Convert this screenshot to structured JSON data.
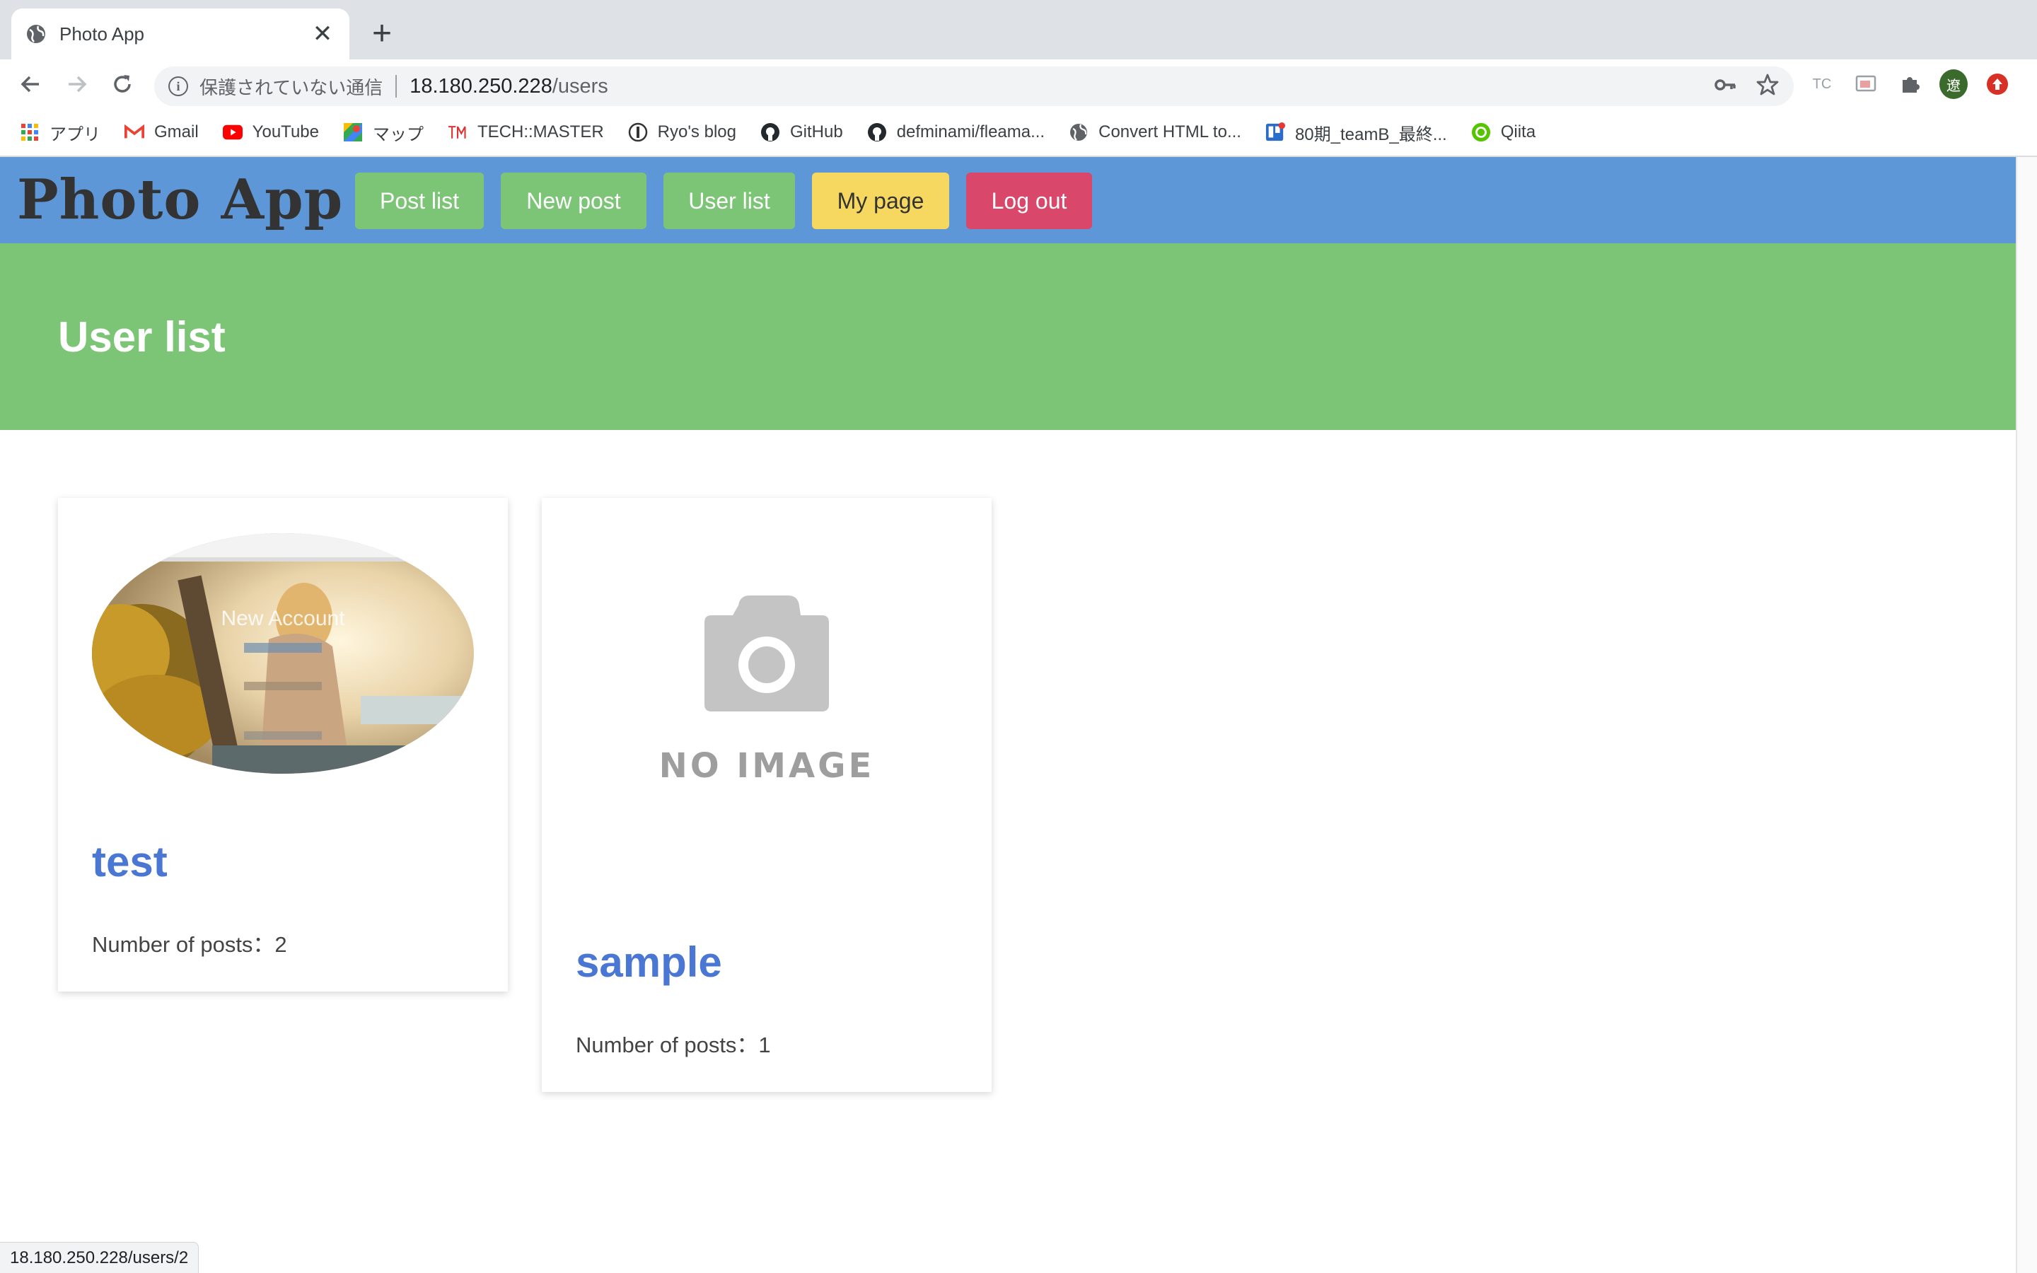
{
  "browser": {
    "tab_title": "Photo App",
    "new_tab_symbol": "+",
    "close_symbol": "✕",
    "security_text": "保護されていない通信",
    "url_host": "18.180.250.228",
    "url_path": "/users",
    "profile_initial": "遼",
    "ext_tc": "TC",
    "status_url": "18.180.250.228/users/2",
    "bookmarks": [
      {
        "label": "アプリ",
        "icon": "apps-grid-icon"
      },
      {
        "label": "Gmail",
        "icon": "gmail-icon"
      },
      {
        "label": "YouTube",
        "icon": "youtube-icon"
      },
      {
        "label": "マップ",
        "icon": "maps-icon"
      },
      {
        "label": "TECH::MASTER",
        "icon": "techmaster-icon"
      },
      {
        "label": "Ryo's blog",
        "icon": "blog-icon"
      },
      {
        "label": "GitHub",
        "icon": "github-icon"
      },
      {
        "label": "defminami/fleama...",
        "icon": "github-icon"
      },
      {
        "label": "Convert HTML to...",
        "icon": "globe-icon"
      },
      {
        "label": "80期_teamB_最終...",
        "icon": "trello-icon"
      },
      {
        "label": "Qiita",
        "icon": "qiita-icon"
      }
    ]
  },
  "app": {
    "brand": "Photo App",
    "nav": {
      "post_list": "Post list",
      "new_post": "New post",
      "user_list": "User list",
      "my_page": "My page",
      "log_out": "Log out"
    },
    "colors": {
      "navbar": "#5d97d8",
      "hero": "#7dc576",
      "success": "#7dc576",
      "warning": "#f6d860",
      "danger": "#d9476b",
      "link": "#4a77d4"
    },
    "page_title": "User list",
    "users": [
      {
        "name": "test",
        "posts_label": "Number of posts：2",
        "image": "user-photo",
        "image_caption": "New Account"
      },
      {
        "name": "sample",
        "posts_label": "Number of posts：1",
        "image": "no-image-placeholder",
        "image_caption": "NO IMAGE"
      }
    ]
  }
}
